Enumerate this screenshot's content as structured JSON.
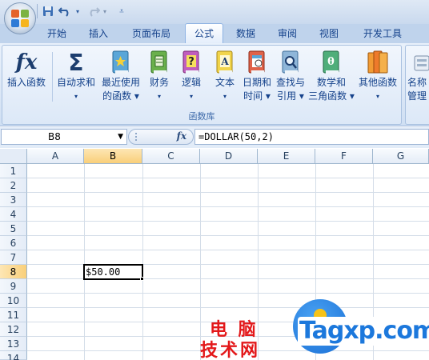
{
  "ribbon_tabs": [
    {
      "label": "开始"
    },
    {
      "label": "插入"
    },
    {
      "label": "页面布局"
    },
    {
      "label": "公式",
      "active": true
    },
    {
      "label": "数据"
    },
    {
      "label": "审阅"
    },
    {
      "label": "视图"
    },
    {
      "label": "开发工具"
    }
  ],
  "ribbon": {
    "group_label": "函数库",
    "buttons": [
      {
        "line1": "插入函数",
        "line2": "",
        "icon": "fx-icon"
      },
      {
        "line1": "自动求和",
        "line2": "▾",
        "icon": "sigma-icon"
      },
      {
        "line1": "最近使用",
        "line2": "的函数 ▾",
        "icon": "recent-functions-book-icon"
      },
      {
        "line1": "财务",
        "line2": "▾",
        "icon": "financial-book-icon"
      },
      {
        "line1": "逻辑",
        "line2": "▾",
        "icon": "logical-book-icon"
      },
      {
        "line1": "文本",
        "line2": "▾",
        "icon": "text-book-icon"
      },
      {
        "line1": "日期和",
        "line2": "时间 ▾",
        "icon": "date-time-book-icon"
      },
      {
        "line1": "查找与",
        "line2": "引用 ▾",
        "icon": "lookup-book-icon"
      },
      {
        "line1": "数学和",
        "line2": "三角函数 ▾",
        "icon": "math-trig-book-icon"
      },
      {
        "line1": "其他函数",
        "line2": "▾",
        "icon": "more-functions-book-icon"
      }
    ],
    "partial_button": {
      "line1": "名称",
      "line2": "管理",
      "icon": "name-manager-icon"
    }
  },
  "formula_bar": {
    "name_box": "B8",
    "fx_label": "fx",
    "formula": "=DOLLAR(50,2)"
  },
  "sheet": {
    "columns": [
      "A",
      "B",
      "C",
      "D",
      "E",
      "F",
      "G"
    ],
    "rows": [
      "1",
      "2",
      "3",
      "4",
      "5",
      "6",
      "7",
      "8",
      "9",
      "10",
      "11",
      "12",
      "13",
      "14"
    ],
    "selected_column": "B",
    "selected_row": "8",
    "cells": {
      "B8": "$50.00"
    }
  },
  "watermark": {
    "line1": "电 脑",
    "line2": "技术网",
    "brand": "Tagxp.com"
  },
  "colors": {
    "ribbon_text": "#15428b",
    "selection_header": "#f9cf79",
    "watermark_red": "#e3191b",
    "watermark_blue": "#1c78dc"
  }
}
